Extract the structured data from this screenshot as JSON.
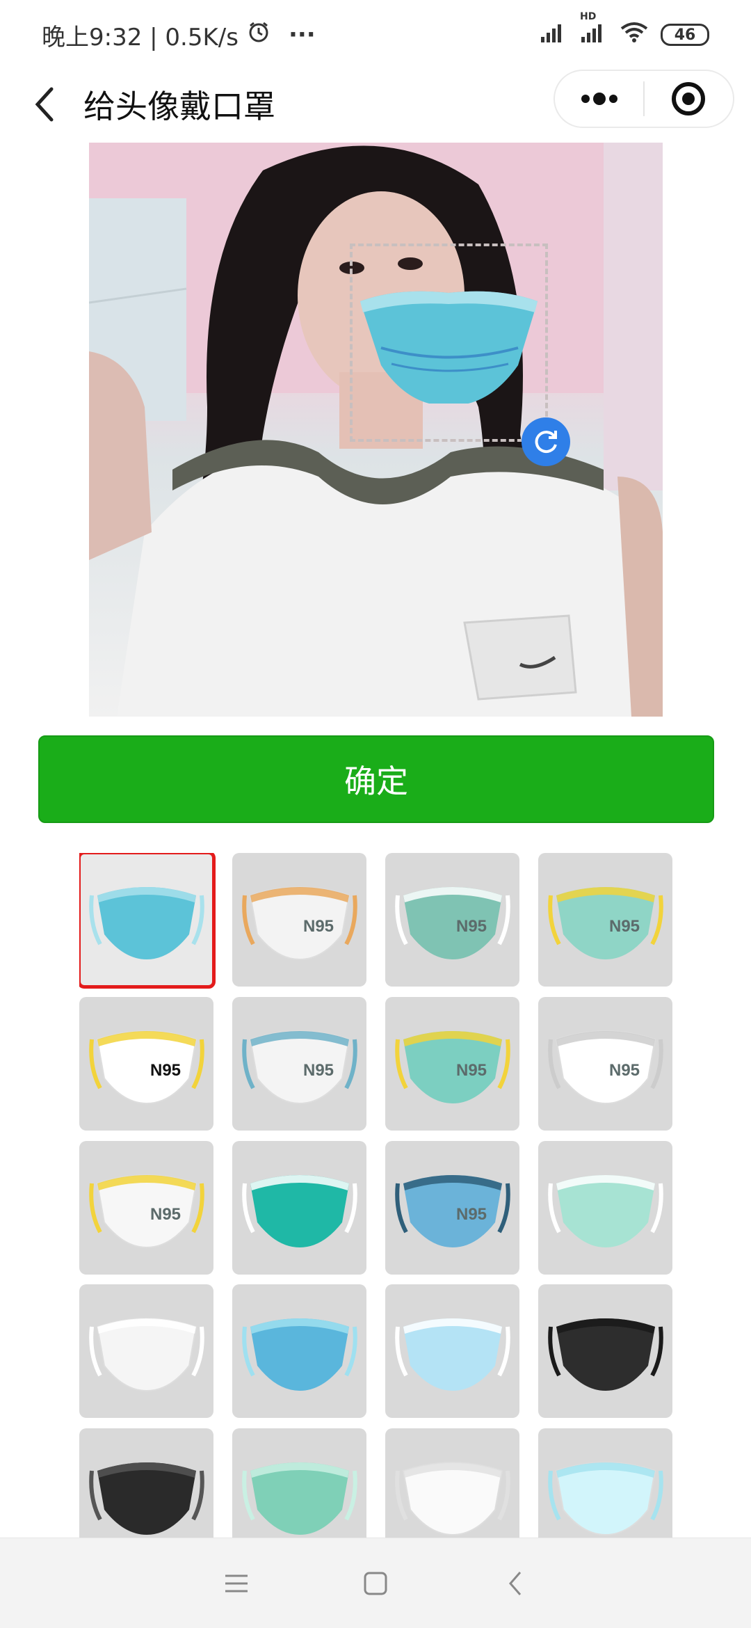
{
  "status_bar": {
    "time_and_speed": "晚上9:32 | 0.5K/s",
    "more_dots": "···",
    "hd_label": "HD",
    "battery": "46"
  },
  "nav": {
    "title": "给头像戴口罩"
  },
  "confirm": {
    "label": "确定"
  },
  "masks": [
    {
      "style": "surgical-blue",
      "label": "",
      "selected": true
    },
    {
      "style": "n95-white-orange",
      "label": "N95",
      "selected": false
    },
    {
      "style": "n95-green",
      "label": "N95",
      "selected": false
    },
    {
      "style": "n95-mint-yellow",
      "label": "N95",
      "selected": false
    },
    {
      "style": "n95-white-yellow",
      "label": "N95",
      "selected": false
    },
    {
      "style": "n95-white-valve",
      "label": "N95",
      "selected": false
    },
    {
      "style": "n95-teal-small",
      "label": "N95",
      "selected": false
    },
    {
      "style": "n95-white-folded",
      "label": "N95",
      "selected": false
    },
    {
      "style": "n95-white-yellow-straps",
      "label": "N95",
      "selected": false
    },
    {
      "style": "teal-shield",
      "label": "",
      "selected": false
    },
    {
      "style": "n95-blue-crumpled",
      "label": "N95",
      "selected": false
    },
    {
      "style": "surgical-mint-loops",
      "label": "",
      "selected": false
    },
    {
      "style": "white-rect",
      "label": "",
      "selected": false
    },
    {
      "style": "surgical-blue-2",
      "label": "",
      "selected": false
    },
    {
      "style": "surgical-light-blue",
      "label": "",
      "selected": false
    },
    {
      "style": "black-cloth",
      "label": "",
      "selected": false
    },
    {
      "style": "black-valve",
      "label": "",
      "selected": false
    },
    {
      "style": "surgical-green",
      "label": "",
      "selected": false
    },
    {
      "style": "white-surgical",
      "label": "",
      "selected": false
    },
    {
      "style": "light-cyan",
      "label": "",
      "selected": false
    }
  ]
}
